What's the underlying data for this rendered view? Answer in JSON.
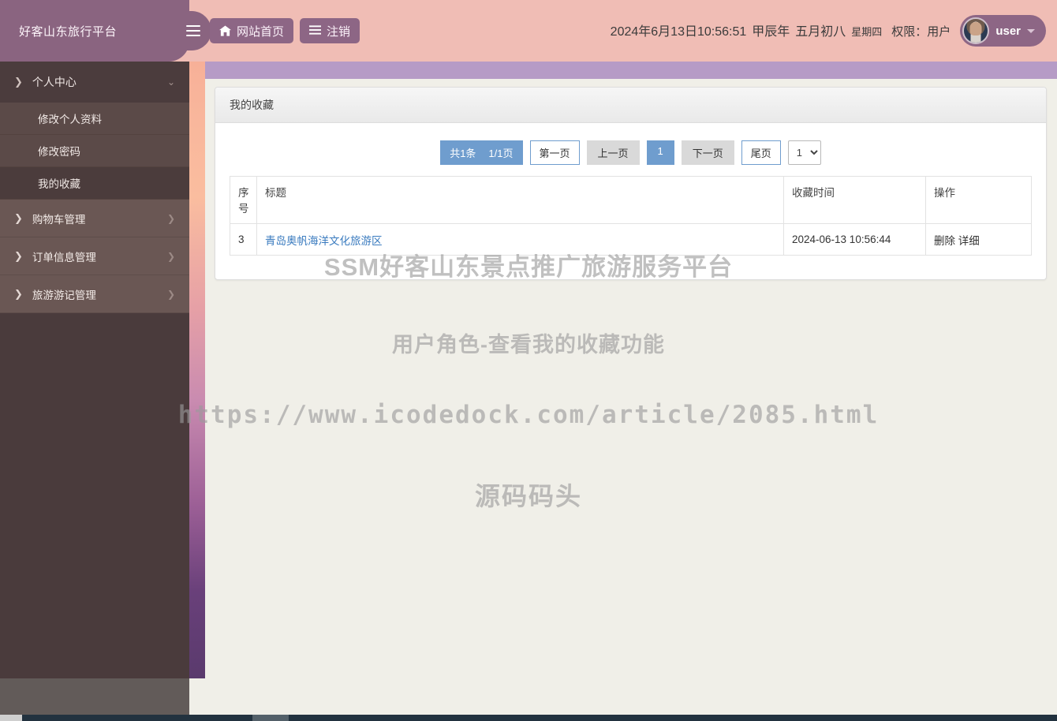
{
  "header": {
    "brand": "好客山东旅行平台",
    "menu_toggle_icon": "hamburger-icon",
    "home_button": "网站首页",
    "logout_button": "注销",
    "datetime": "2024年6月13日10:56:51",
    "lunar_year": "甲辰年",
    "lunar_date": "五月初八",
    "weekday": "星期四",
    "permission": "权限：用户",
    "username": "user"
  },
  "sidebar": {
    "sections": [
      {
        "label": "个人中心",
        "expanded": true,
        "children": [
          {
            "label": "修改个人资料",
            "active": false
          },
          {
            "label": "修改密码",
            "active": false
          },
          {
            "label": "我的收藏",
            "active": true
          }
        ]
      },
      {
        "label": "购物车管理",
        "expanded": false,
        "children": []
      },
      {
        "label": "订单信息管理",
        "expanded": false,
        "children": []
      },
      {
        "label": "旅游游记管理",
        "expanded": false,
        "children": []
      }
    ]
  },
  "panel": {
    "title": "我的收藏"
  },
  "pagination": {
    "total_text": "共1条",
    "page_text": "1/1页",
    "first": "第一页",
    "prev": "上一页",
    "current": "1",
    "next": "下一页",
    "last": "尾页",
    "page_select_value": "1",
    "page_select_options": [
      "1"
    ]
  },
  "table": {
    "columns": [
      "序号",
      "标题",
      "收藏时间",
      "操作"
    ],
    "rows": [
      {
        "index": "3",
        "title": "青岛奥帆海洋文化旅游区",
        "time": "2024-06-13 10:56:44",
        "action_delete": "删除",
        "action_detail": "详细"
      }
    ]
  },
  "watermarks": {
    "line1": "SSM好客山东景点推广旅游服务平台",
    "line2": "用户角色-查看我的收藏功能",
    "line3": "https://www.icodedock.com/article/2085.html",
    "line4": "源码码头"
  },
  "colors": {
    "header_bg": "#f0bdb5",
    "brand_bg": "#8a6480",
    "purple_band": "#b69bc6",
    "sidebar_bg": "#4a3b3c",
    "accent_blue": "#6f9dce",
    "link_blue": "#3a7bbf",
    "content_bg": "#f0efe8"
  }
}
